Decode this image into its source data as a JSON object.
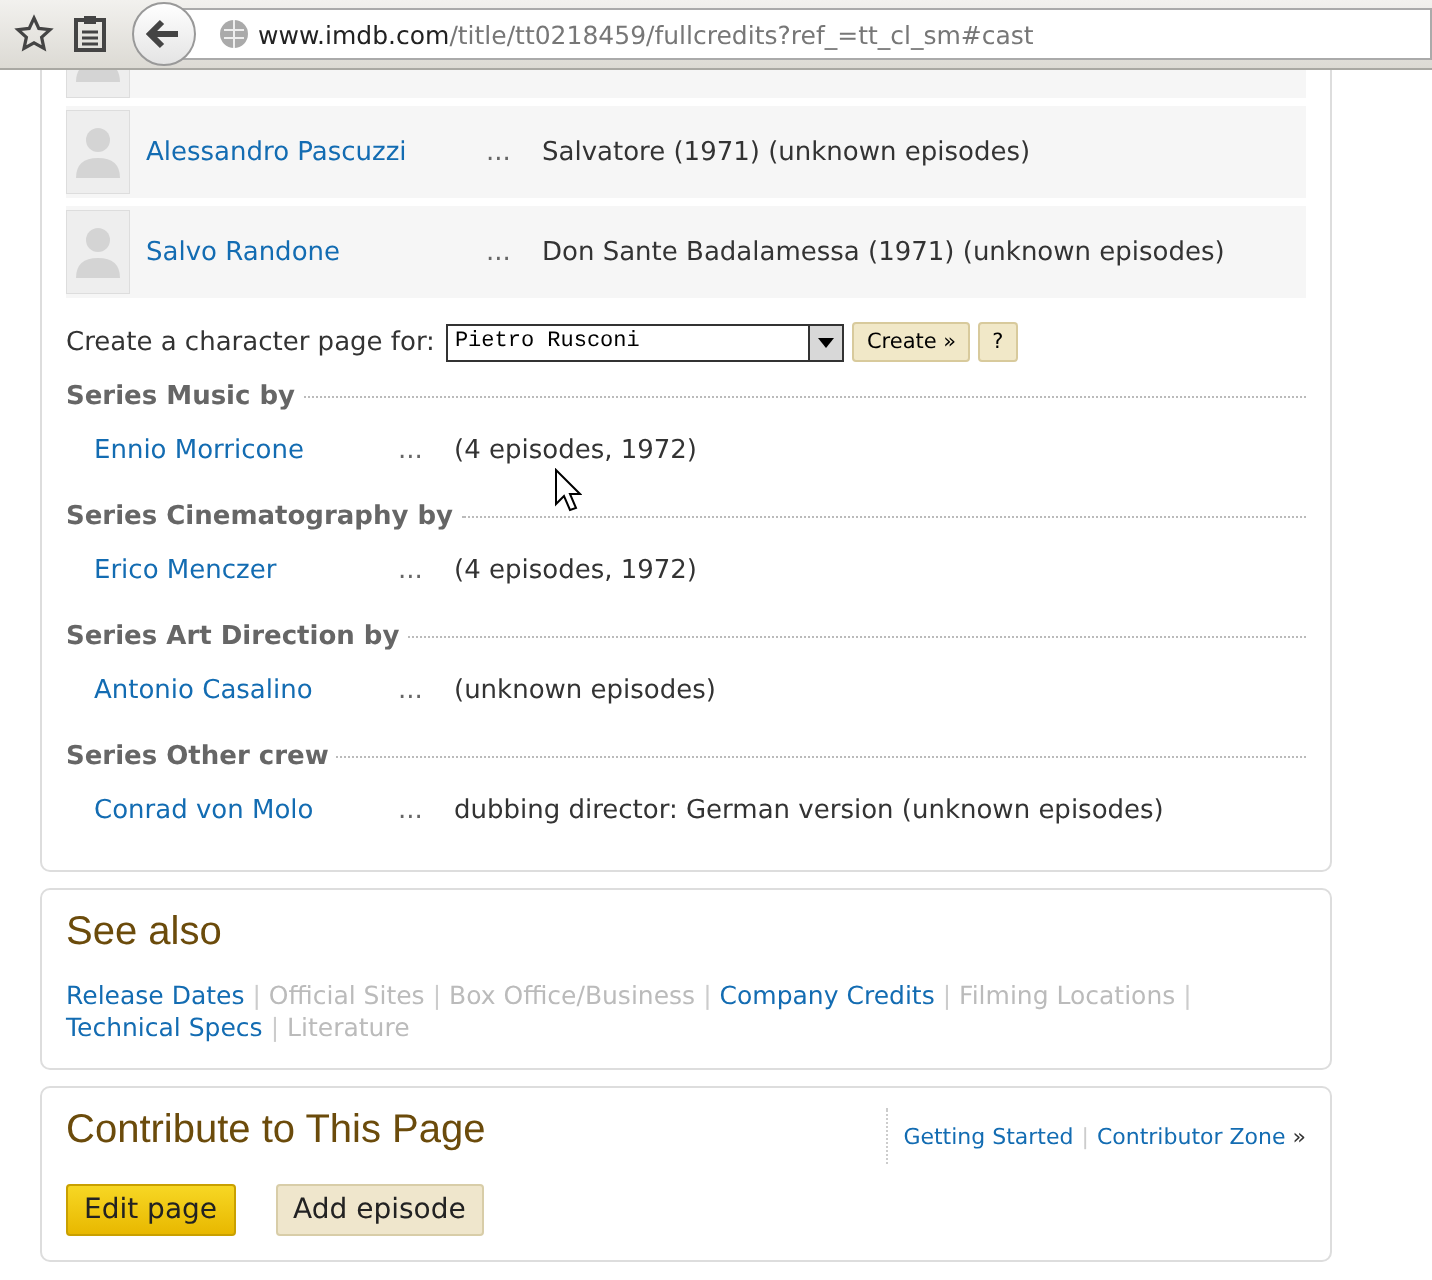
{
  "browser": {
    "url_host": "www.imdb.com",
    "url_path": "/title/tt0218459/fullcredits?ref_=tt_cl_sm#cast"
  },
  "cast": [
    {
      "name": "Alessandro Pascuzzi",
      "dots": "...",
      "character": "Salvatore (1971) (unknown episodes)"
    },
    {
      "name": "Salvo Randone",
      "dots": "...",
      "character": "Don Sante Badalamessa (1971) (unknown episodes)"
    }
  ],
  "character_page": {
    "label": "Create a character page for:",
    "selection": "Pietro Rusconi",
    "create_button": "Create »",
    "help_button": "?"
  },
  "crew_sections": [
    {
      "heading": "Series Music by",
      "people": [
        {
          "name": "Ennio Morricone",
          "dots": "...",
          "credit": "(4 episodes, 1972)"
        }
      ]
    },
    {
      "heading": "Series Cinematography by",
      "people": [
        {
          "name": "Erico Menczer",
          "dots": "...",
          "credit": "(4 episodes, 1972)"
        }
      ]
    },
    {
      "heading": "Series Art Direction by",
      "people": [
        {
          "name": "Antonio Casalino",
          "dots": "...",
          "credit": "(unknown episodes)"
        }
      ]
    },
    {
      "heading": "Series Other crew",
      "people": [
        {
          "name": "Conrad von Molo",
          "dots": "...",
          "credit": "dubbing director: German version (unknown episodes)"
        }
      ]
    }
  ],
  "see_also": {
    "title": "See also",
    "separator": "|",
    "links": [
      {
        "label": "Release Dates",
        "disabled": false
      },
      {
        "label": "Official Sites",
        "disabled": true
      },
      {
        "label": "Box Office/Business",
        "disabled": true
      },
      {
        "label": "Company Credits",
        "disabled": false
      },
      {
        "label": "Filming Locations",
        "disabled": true
      },
      {
        "label": "Technical Specs",
        "disabled": false
      },
      {
        "label": "Literature",
        "disabled": true
      }
    ]
  },
  "contribute": {
    "title": "Contribute to This Page",
    "links": [
      "Getting Started",
      "Contributor Zone"
    ],
    "separator": "|",
    "more": "»",
    "buttons": [
      {
        "label": "Edit page",
        "kind": "primary"
      },
      {
        "label": "Add episode",
        "kind": "secondary"
      }
    ]
  }
}
